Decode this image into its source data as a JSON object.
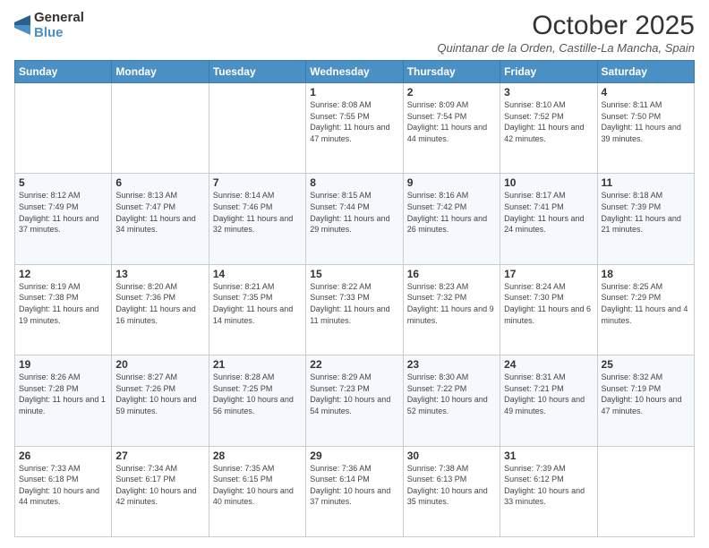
{
  "logo": {
    "general": "General",
    "blue": "Blue"
  },
  "header": {
    "month": "October 2025",
    "location": "Quintanar de la Orden, Castille-La Mancha, Spain"
  },
  "weekdays": [
    "Sunday",
    "Monday",
    "Tuesday",
    "Wednesday",
    "Thursday",
    "Friday",
    "Saturday"
  ],
  "weeks": [
    [
      {
        "day": "",
        "info": ""
      },
      {
        "day": "",
        "info": ""
      },
      {
        "day": "",
        "info": ""
      },
      {
        "day": "1",
        "info": "Sunrise: 8:08 AM\nSunset: 7:55 PM\nDaylight: 11 hours and 47 minutes."
      },
      {
        "day": "2",
        "info": "Sunrise: 8:09 AM\nSunset: 7:54 PM\nDaylight: 11 hours and 44 minutes."
      },
      {
        "day": "3",
        "info": "Sunrise: 8:10 AM\nSunset: 7:52 PM\nDaylight: 11 hours and 42 minutes."
      },
      {
        "day": "4",
        "info": "Sunrise: 8:11 AM\nSunset: 7:50 PM\nDaylight: 11 hours and 39 minutes."
      }
    ],
    [
      {
        "day": "5",
        "info": "Sunrise: 8:12 AM\nSunset: 7:49 PM\nDaylight: 11 hours and 37 minutes."
      },
      {
        "day": "6",
        "info": "Sunrise: 8:13 AM\nSunset: 7:47 PM\nDaylight: 11 hours and 34 minutes."
      },
      {
        "day": "7",
        "info": "Sunrise: 8:14 AM\nSunset: 7:46 PM\nDaylight: 11 hours and 32 minutes."
      },
      {
        "day": "8",
        "info": "Sunrise: 8:15 AM\nSunset: 7:44 PM\nDaylight: 11 hours and 29 minutes."
      },
      {
        "day": "9",
        "info": "Sunrise: 8:16 AM\nSunset: 7:42 PM\nDaylight: 11 hours and 26 minutes."
      },
      {
        "day": "10",
        "info": "Sunrise: 8:17 AM\nSunset: 7:41 PM\nDaylight: 11 hours and 24 minutes."
      },
      {
        "day": "11",
        "info": "Sunrise: 8:18 AM\nSunset: 7:39 PM\nDaylight: 11 hours and 21 minutes."
      }
    ],
    [
      {
        "day": "12",
        "info": "Sunrise: 8:19 AM\nSunset: 7:38 PM\nDaylight: 11 hours and 19 minutes."
      },
      {
        "day": "13",
        "info": "Sunrise: 8:20 AM\nSunset: 7:36 PM\nDaylight: 11 hours and 16 minutes."
      },
      {
        "day": "14",
        "info": "Sunrise: 8:21 AM\nSunset: 7:35 PM\nDaylight: 11 hours and 14 minutes."
      },
      {
        "day": "15",
        "info": "Sunrise: 8:22 AM\nSunset: 7:33 PM\nDaylight: 11 hours and 11 minutes."
      },
      {
        "day": "16",
        "info": "Sunrise: 8:23 AM\nSunset: 7:32 PM\nDaylight: 11 hours and 9 minutes."
      },
      {
        "day": "17",
        "info": "Sunrise: 8:24 AM\nSunset: 7:30 PM\nDaylight: 11 hours and 6 minutes."
      },
      {
        "day": "18",
        "info": "Sunrise: 8:25 AM\nSunset: 7:29 PM\nDaylight: 11 hours and 4 minutes."
      }
    ],
    [
      {
        "day": "19",
        "info": "Sunrise: 8:26 AM\nSunset: 7:28 PM\nDaylight: 11 hours and 1 minute."
      },
      {
        "day": "20",
        "info": "Sunrise: 8:27 AM\nSunset: 7:26 PM\nDaylight: 10 hours and 59 minutes."
      },
      {
        "day": "21",
        "info": "Sunrise: 8:28 AM\nSunset: 7:25 PM\nDaylight: 10 hours and 56 minutes."
      },
      {
        "day": "22",
        "info": "Sunrise: 8:29 AM\nSunset: 7:23 PM\nDaylight: 10 hours and 54 minutes."
      },
      {
        "day": "23",
        "info": "Sunrise: 8:30 AM\nSunset: 7:22 PM\nDaylight: 10 hours and 52 minutes."
      },
      {
        "day": "24",
        "info": "Sunrise: 8:31 AM\nSunset: 7:21 PM\nDaylight: 10 hours and 49 minutes."
      },
      {
        "day": "25",
        "info": "Sunrise: 8:32 AM\nSunset: 7:19 PM\nDaylight: 10 hours and 47 minutes."
      }
    ],
    [
      {
        "day": "26",
        "info": "Sunrise: 7:33 AM\nSunset: 6:18 PM\nDaylight: 10 hours and 44 minutes."
      },
      {
        "day": "27",
        "info": "Sunrise: 7:34 AM\nSunset: 6:17 PM\nDaylight: 10 hours and 42 minutes."
      },
      {
        "day": "28",
        "info": "Sunrise: 7:35 AM\nSunset: 6:15 PM\nDaylight: 10 hours and 40 minutes."
      },
      {
        "day": "29",
        "info": "Sunrise: 7:36 AM\nSunset: 6:14 PM\nDaylight: 10 hours and 37 minutes."
      },
      {
        "day": "30",
        "info": "Sunrise: 7:38 AM\nSunset: 6:13 PM\nDaylight: 10 hours and 35 minutes."
      },
      {
        "day": "31",
        "info": "Sunrise: 7:39 AM\nSunset: 6:12 PM\nDaylight: 10 hours and 33 minutes."
      },
      {
        "day": "",
        "info": ""
      }
    ]
  ]
}
